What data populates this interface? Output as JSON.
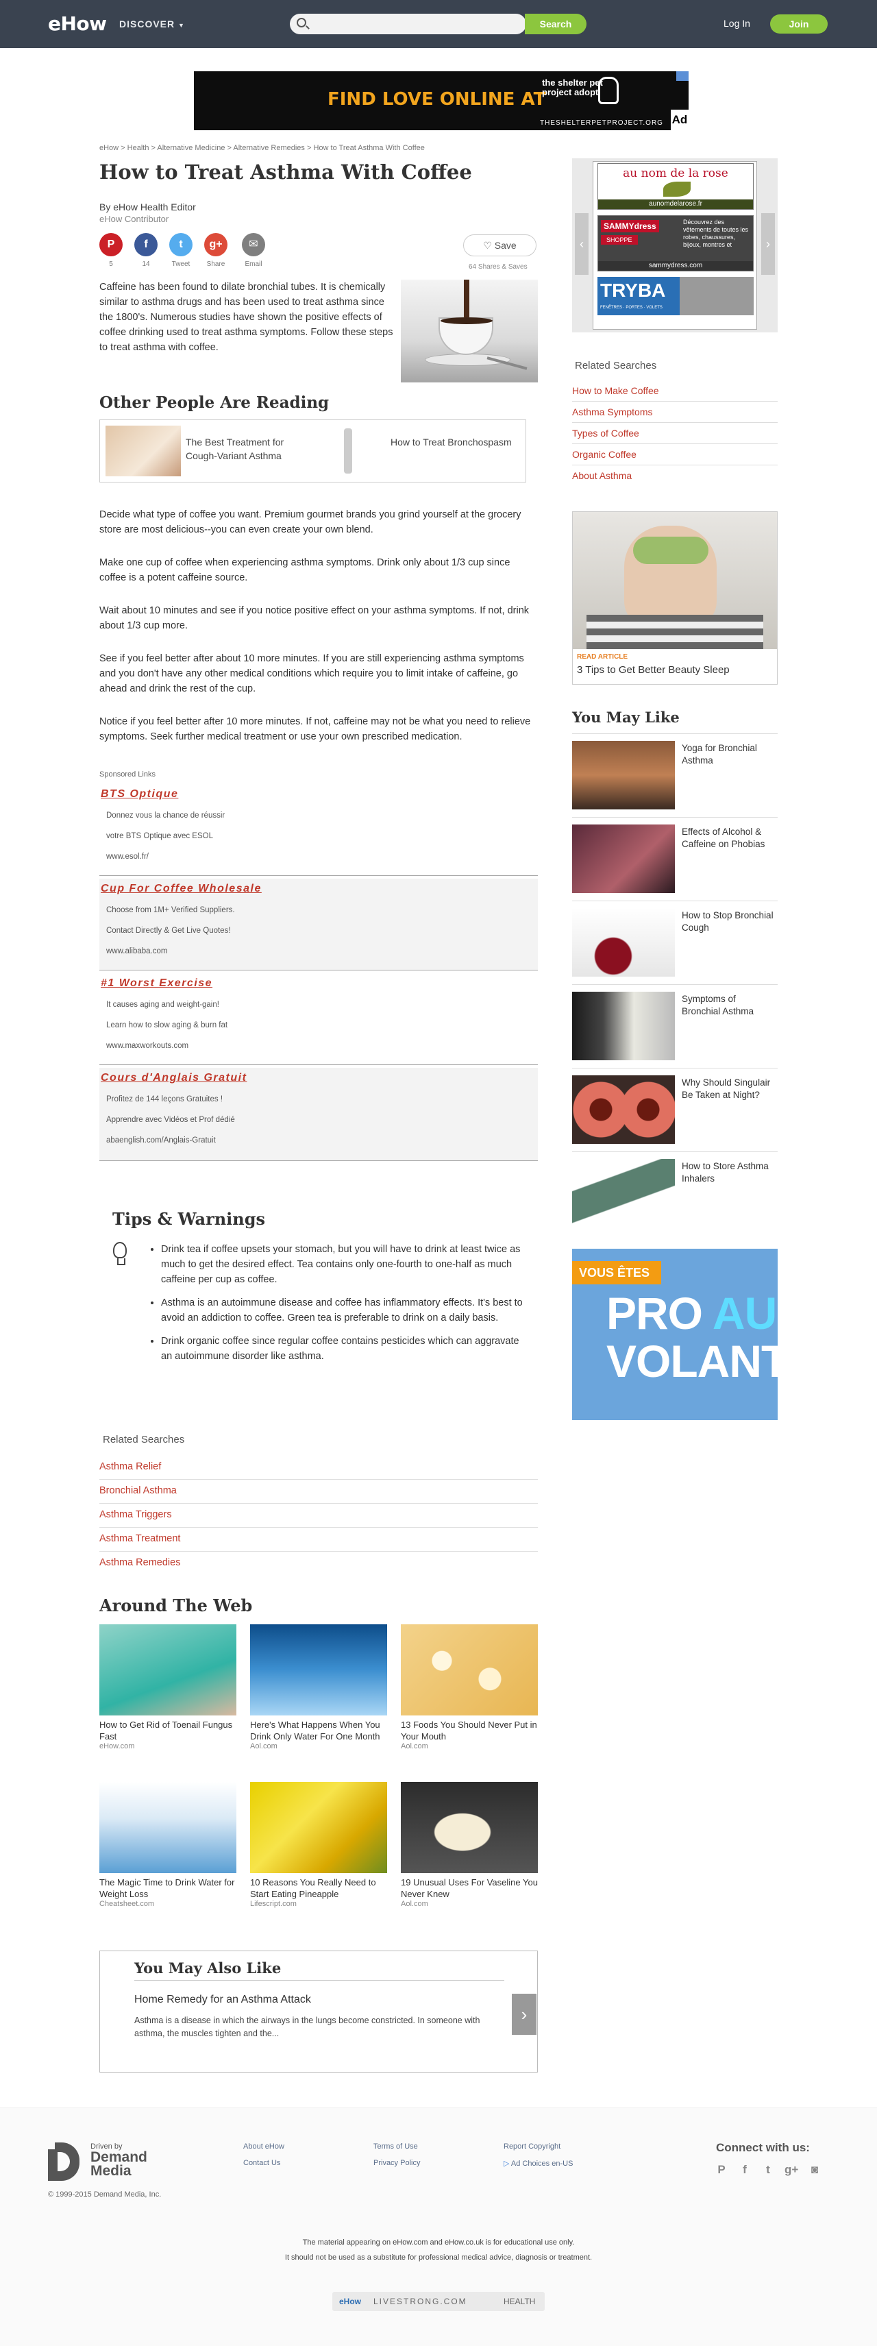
{
  "header": {
    "logo": "eHow",
    "discover": "DISCOVER",
    "search_placeholder": "",
    "search_button": "Search",
    "login": "Log In",
    "join": "Join"
  },
  "top_ad": {
    "headline": "FIND LOVE ONLINE AT",
    "brand": "the shelter pet project adopt",
    "url": "THESHELTERPETPROJECT.ORG",
    "ad_choice": "Ad"
  },
  "breadcrumb": "eHow > Health > Alternative Medicine > Alternative Remedies > How to Treat Asthma With Coffee",
  "article": {
    "title": "How to Treat Asthma With Coffee",
    "byline": "By eHow Health Editor",
    "contributor": "eHow Contributor",
    "share": [
      {
        "label": "5",
        "glyph": "P",
        "color": "#cb2027",
        "icon": "pinterest-icon"
      },
      {
        "label": "14",
        "glyph": "f",
        "color": "#3b5998",
        "icon": "facebook-icon"
      },
      {
        "label": "Tweet",
        "glyph": "t",
        "color": "#55acee",
        "icon": "twitter-icon"
      },
      {
        "label": "Share",
        "glyph": "g+",
        "color": "#dd4b39",
        "icon": "googleplus-icon"
      },
      {
        "label": "Email",
        "glyph": "✉",
        "color": "#7f7f7f",
        "icon": "email-icon"
      }
    ],
    "save": "Save",
    "save_count": "64 Shares & Saves",
    "intro": "Caffeine has been found to dilate bronchial tubes. It is chemically similar to asthma drugs and has been used to treat asthma since the 1800's. Numerous studies have shown the positive effects of coffee drinking used to treat asthma symptoms. Follow these steps to treat asthma with coffee.",
    "other_reading_title": "Other People Are Reading",
    "other_reading": [
      "The Best Treatment for Cough-Variant Asthma",
      "How to Treat Bronchospasm"
    ],
    "steps": [
      "Decide what type of coffee you want. Premium gourmet brands you grind yourself at the grocery store are most delicious--you can even create your own blend.",
      "Make one cup of coffee when experiencing asthma symptoms. Drink only about 1/3 cup since coffee is a potent caffeine source.",
      "Wait about 10 minutes and see if you notice positive effect on your asthma symptoms. If not, drink about 1/3 cup more.",
      "See if you feel better after about 10 more minutes. If you are still experiencing asthma symptoms and you don't have any other medical conditions which require you to limit intake of caffeine, go ahead and drink the rest of the cup.",
      "Notice if you feel better after 10 more minutes. If not, caffeine may not be what you need to relieve symptoms. Seek further medical treatment or use your own prescribed medication."
    ]
  },
  "sponsored": {
    "label": "Sponsored Links",
    "items": [
      {
        "title": "BTS Optique",
        "lines": [
          "Donnez vous la chance de réussir",
          "votre BTS Optique avec ESOL",
          "www.esol.fr/"
        ]
      },
      {
        "title": "Cup For Coffee Wholesale",
        "lines": [
          "Choose from 1M+ Verified Suppliers.",
          "Contact Directly & Get Live Quotes!",
          "www.alibaba.com"
        ]
      },
      {
        "title": "#1 Worst Exercise",
        "lines": [
          "It causes aging and weight-gain!",
          "Learn how to slow aging & burn fat",
          "www.maxworkouts.com"
        ]
      },
      {
        "title": "Cours d'Anglais Gratuit",
        "lines": [
          "Profitez de 144 leçons Gratuites !",
          "Apprendre avec Vidéos et Prof dédié",
          "abaenglish.com/Anglais-Gratuit"
        ]
      }
    ]
  },
  "tips": {
    "title": "Tips & Warnings",
    "items": [
      "Drink tea if coffee upsets your stomach, but you will have to drink at least twice as much to get the desired effect. Tea contains only one-fourth to one-half as much caffeine per cup as coffee.",
      "Asthma is an autoimmune disease and coffee has inflammatory effects. It's best to avoid an addiction to coffee. Green tea is preferable to drink on a daily basis.",
      "Drink organic coffee since regular coffee contains pesticides which can aggravate an autoimmune disorder like asthma."
    ]
  },
  "related_bottom": {
    "title": "Related Searches",
    "links": [
      "Asthma Relief",
      "Bronchial Asthma",
      "Asthma Triggers",
      "Asthma Treatment",
      "Asthma Remedies"
    ]
  },
  "around_web": {
    "title": "Around The Web",
    "items": [
      {
        "caption": "How to Get Rid of Toenail Fungus Fast",
        "source": "eHow.com"
      },
      {
        "caption": "Here's What Happens When You Drink Only Water For One Month",
        "source": "Aol.com"
      },
      {
        "caption": "13 Foods You Should Never Put in Your Mouth",
        "source": "Aol.com"
      },
      {
        "caption": "The Magic Time to Drink Water for Weight Loss",
        "source": "Cheatsheet.com"
      },
      {
        "caption": "10 Reasons You Really Need to Start Eating Pineapple",
        "source": "Lifescript.com"
      },
      {
        "caption": "19 Unusual Uses For Vaseline You Never Knew",
        "source": "Aol.com"
      }
    ]
  },
  "you_may_also_like": {
    "title": "You May Also Like",
    "headline": "Home Remedy for an Asthma Attack",
    "desc": "Asthma is a disease in which the airways in the lungs become constricted. In someone with asthma, the muscles tighten and the...",
    "arrow": "›"
  },
  "sidebar": {
    "ad": {
      "brand1": "au nom de la rose",
      "brand1_url": "aunomdelarose.fr",
      "brand2": "SAMMYdress",
      "brand2_cta": "SHOPPE",
      "brand2_text": "Découvrez des vêtements de toutes les robes, chaussures, bijoux, montres et",
      "brand2_url": "sammydress.com",
      "brand3": "TRYBA",
      "brand3_sub": "FENÊTRES · PORTES · VOLETS",
      "prev": "‹",
      "next": "›"
    },
    "related_title": "Related Searches",
    "related_links": [
      "How to Make Coffee",
      "Asthma Symptoms",
      "Types of Coffee",
      "Organic Coffee",
      "About Asthma"
    ],
    "read_article_tag": "READ ARTICLE",
    "read_article_title": "3 Tips to Get Better Beauty Sleep",
    "you_may_like_title": "You May Like",
    "you_may_like": [
      "Yoga for Bronchial Asthma",
      "Effects of Alcohol & Caffeine on Phobias",
      "How to Stop Bronchial Cough",
      "Symptoms of Bronchial Asthma",
      "Why Should Singulair Be Taken at Night?",
      "How to Store Asthma Inhalers"
    ],
    "pro_ad": {
      "badge": "VOUS ÊTES",
      "w1": "PRO",
      "w2": "AU",
      "w3": "VOLANT"
    }
  },
  "footer": {
    "driven_by": "Driven by",
    "demand_media": "Demand Media",
    "copyright": "© 1999-2015 Demand Media, Inc.",
    "links": [
      "About eHow",
      "Contact Us",
      "Terms of Use",
      "Privacy Policy",
      "Report Copyright",
      "Ad Choices en-US"
    ],
    "connect": "Connect with us:",
    "social": [
      "P",
      "f",
      "t",
      "g+",
      "◙"
    ],
    "disclaimer1": "The material appearing on eHow.com and eHow.co.uk is for educational use only.",
    "disclaimer2": "It should not be used as a substitute for professional medical advice, diagnosis or treatment.",
    "brands": [
      "eHow",
      "LIVESTRONG.COM",
      "HEALTH"
    ]
  }
}
